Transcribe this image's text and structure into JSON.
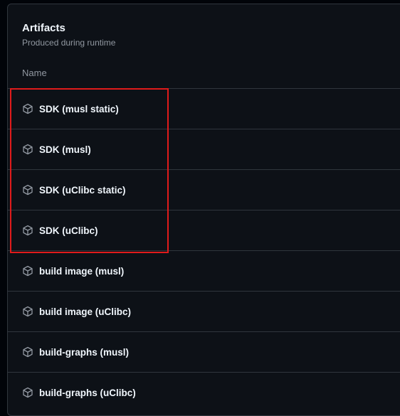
{
  "artifacts": {
    "title": "Artifacts",
    "subtitle": "Produced during runtime",
    "column_header": "Name",
    "items": [
      {
        "label": "SDK (musl static)",
        "icon": "package-icon"
      },
      {
        "label": "SDK (musl)",
        "icon": "package-icon"
      },
      {
        "label": "SDK (uClibc static)",
        "icon": "package-icon"
      },
      {
        "label": "SDK (uClibc)",
        "icon": "package-icon"
      },
      {
        "label": "build image (musl)",
        "icon": "package-icon"
      },
      {
        "label": "build image (uClibc)",
        "icon": "package-icon"
      },
      {
        "label": "build-graphs (musl)",
        "icon": "package-icon"
      },
      {
        "label": "build-graphs (uClibc)",
        "icon": "package-icon"
      }
    ]
  },
  "colors": {
    "background": "#0d1117",
    "border": "#30363d",
    "text_primary": "#f0f6fc",
    "text_muted": "#9198a1",
    "highlight": "#e01b1b"
  }
}
